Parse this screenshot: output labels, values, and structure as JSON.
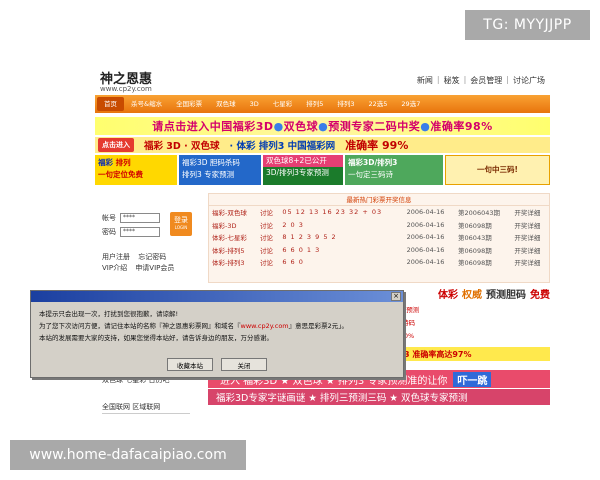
{
  "watermark_top": "TG: MYYJJPP",
  "watermark_bottom": "www.home-dafacaipiao.com",
  "site": {
    "name": "神之恩惠",
    "url": "www.cp2y.com",
    "top_links": [
      "新闻",
      "秘笈",
      "会员管理",
      "讨论广场"
    ],
    "top_sep": "|"
  },
  "nav": [
    "首页",
    "杀号&缩水",
    "全国彩票",
    "双色球",
    "3D",
    "七星彩",
    "排列5",
    "排列3",
    "22选5",
    "29选7"
  ],
  "banner1": {
    "part1": "请点击进入中国福彩3D",
    "dot": "●",
    "part2": "双色球",
    "part3": "预测专家二码中奖",
    "part4": "准确率98%"
  },
  "banner2": {
    "enter": "点击进入",
    "text_a": "福彩 3D · 双色球",
    "text_b": "· 体彩 排列3  中国福彩网",
    "text_c": "准确率 99%"
  },
  "banner3": {
    "c1_l1": "福彩",
    "c1_l1b": "排列",
    "c1_l2": "一句定位免费",
    "c2_l1": "福彩3D  胆码杀码",
    "c2_l2": "排列3  专家预测",
    "c3_l1": "双色球8+2已公开",
    "c3_l2": "3D/排列3专家预测",
    "c4_l1": "福彩3D/排列3",
    "c4_l2": "一句定三码诗",
    "c5": "一句中三码!"
  },
  "login": {
    "user_label": "帐号",
    "pass_label": "密码",
    "user_value": "****",
    "pass_value": "****",
    "login_button": "登录",
    "login_button_sub": "LOGIN",
    "link_register": "用户注册",
    "link_forgot": "忘记密码",
    "link_vip": "VIP介绍",
    "link_apply": "申请VIP会员"
  },
  "lottery": {
    "title": "最新热门彩票开奖信息",
    "rows": [
      {
        "name": "福彩-双色球",
        "talk": "讨论",
        "numbers": "05 12 13 16 23 32 + 03",
        "date": "2006-04-16",
        "issue": "第2006043期",
        "detail": "开奖详细"
      },
      {
        "name": "福彩-3D",
        "talk": "讨论",
        "numbers": "2 0 3",
        "date": "2006-04-16",
        "issue": "第06098期",
        "detail": "开奖详细"
      },
      {
        "name": "体彩-七星彩",
        "talk": "讨论",
        "numbers": "8 1 2 3 9 5 2",
        "date": "2006-04-16",
        "issue": "第06043期",
        "detail": "开奖详细"
      },
      {
        "name": "体彩-排列5",
        "talk": "讨论",
        "numbers": "6 6 0 1 3",
        "date": "2006-04-16",
        "issue": "第06098期",
        "detail": "开奖详细"
      },
      {
        "name": "体彩-排列3",
        "talk": "讨论",
        "numbers": "6 6 0",
        "date": "2006-04-16",
        "issue": "第06098期",
        "detail": "开奖详细"
      }
    ]
  },
  "promos": {
    "a_tc": "体彩",
    "a_qs": "权威",
    "a_rest": "预测胆码",
    "a_free": "免费",
    "b1": "中国福利彩票3D排列3专家预测",
    "b2": "福彩3D一句定位专家免费特码",
    "b3": "福彩3D必看必赚准确率100%",
    "c": "排列3 准确率高达97%",
    "d_pre": "进入 福彩3D ★ 双色球 ★ 排列3 专家预测准的让你",
    "d_jump": "吓一跳",
    "e": "福彩3D专家字谜画谜 ★ 排列三预测三码 ★ 双色球专家预测"
  },
  "side_bottom": {
    "line1": "双色球 七星彩 日历吧",
    "line2": "全国联网  区域联网"
  },
  "dialog": {
    "line1": "本提示只会出现一次，打扰到您很抱歉，请谅解!",
    "line2a": "为了您下次访问方便，请记住本站的名称『神之恩惠彩票网』和域名『",
    "line2_domain": "www.cp2y.com",
    "line2b": "』意思是彩票2元」。",
    "line3": "本站的发展需要大家的支持，如果您觉得本站好，请告诉身边的朋友，万分感谢。",
    "button_fav": "收藏本站",
    "button_close": "关闭",
    "close_x": "×"
  }
}
